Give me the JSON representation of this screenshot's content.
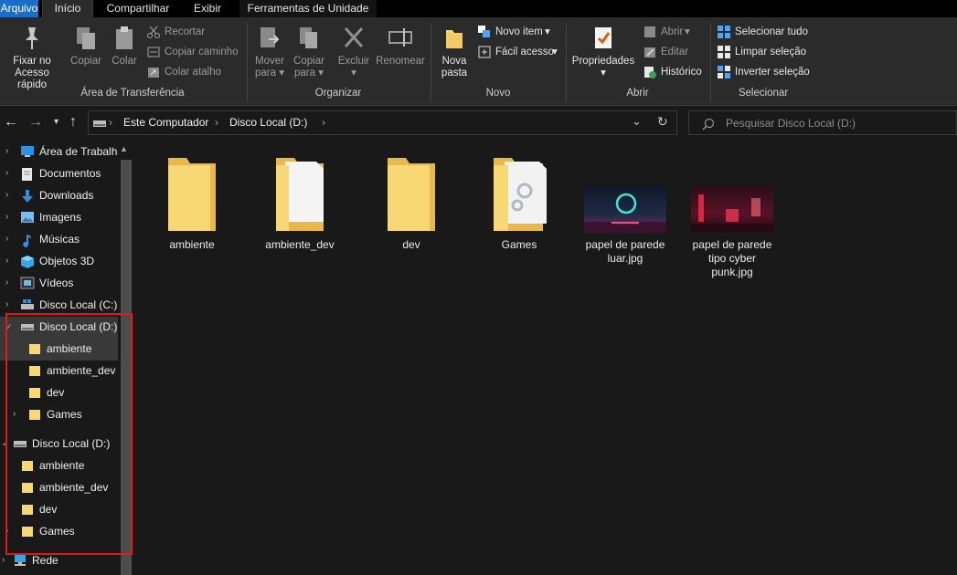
{
  "ribbon_tabs": {
    "arquivo": "Arquivo",
    "inicio": "Início",
    "compartilhar": "Compartilhar",
    "exibir": "Exibir",
    "ferramentas": "Ferramentas de Unidade"
  },
  "clipboard": {
    "pin_line1": "Fixar no",
    "pin_line2": "Acesso rápido",
    "copy": "Copiar",
    "paste": "Colar",
    "cut": "Recortar",
    "copy_path": "Copiar caminho",
    "paste_shortcut": "Colar atalho",
    "label": "Área de Transferência"
  },
  "organize": {
    "move_line1": "Mover",
    "move_line2": "para",
    "copy_line1": "Copiar",
    "copy_line2": "para",
    "delete": "Excluir",
    "rename": "Renomear",
    "label": "Organizar"
  },
  "new": {
    "folder_line1": "Nova",
    "folder_line2": "pasta",
    "new_item": "Novo item",
    "easy_access": "Fácil acesso",
    "label": "Novo"
  },
  "open": {
    "properties": "Propriedades",
    "open": "Abrir",
    "edit": "Editar",
    "history": "Histórico",
    "label": "Abrir"
  },
  "select": {
    "select_all": "Selecionar tudo",
    "clear_selection": "Limpar seleção",
    "invert_selection": "Inverter seleção",
    "label": "Selecionar"
  },
  "address": {
    "crumb1": "Este Computador",
    "crumb2": "Disco Local (D:)",
    "search_placeholder": "Pesquisar Disco Local (D:)"
  },
  "nav_tree": {
    "desktop": "Área de Trabalho",
    "documents": "Documentos",
    "downloads": "Downloads",
    "images": "Imagens",
    "music": "Músicas",
    "objects3d": "Objetos 3D",
    "videos": "Vídeos",
    "disk_c": "Disco Local (C:)",
    "disk_d": "Disco Local (D:)",
    "d_ambiente": "ambiente",
    "d_ambiente_dev": "ambiente_dev",
    "d_dev": "dev",
    "d_games": "Games",
    "disk_d2": "Disco Local (D:)",
    "d2_ambiente": "ambiente",
    "d2_ambiente_dev": "ambiente_dev",
    "d2_dev": "dev",
    "d2_games": "Games",
    "network": "Rede"
  },
  "files": {
    "ambiente": "ambiente",
    "ambiente_dev": "ambiente_dev",
    "dev": "dev",
    "games": "Games",
    "wallpaper1_line1": "papel de parede",
    "wallpaper1_line2": "luar.jpg",
    "wallpaper2_line1": "papel de parede",
    "wallpaper2_line2": "tipo cyber",
    "wallpaper2_line3": "punk.jpg"
  },
  "colors": {
    "accent": "#1a6ec9",
    "folder": "#f8d775",
    "folder_dark": "#e8b84a",
    "highlight_box": "#e01a1a"
  }
}
